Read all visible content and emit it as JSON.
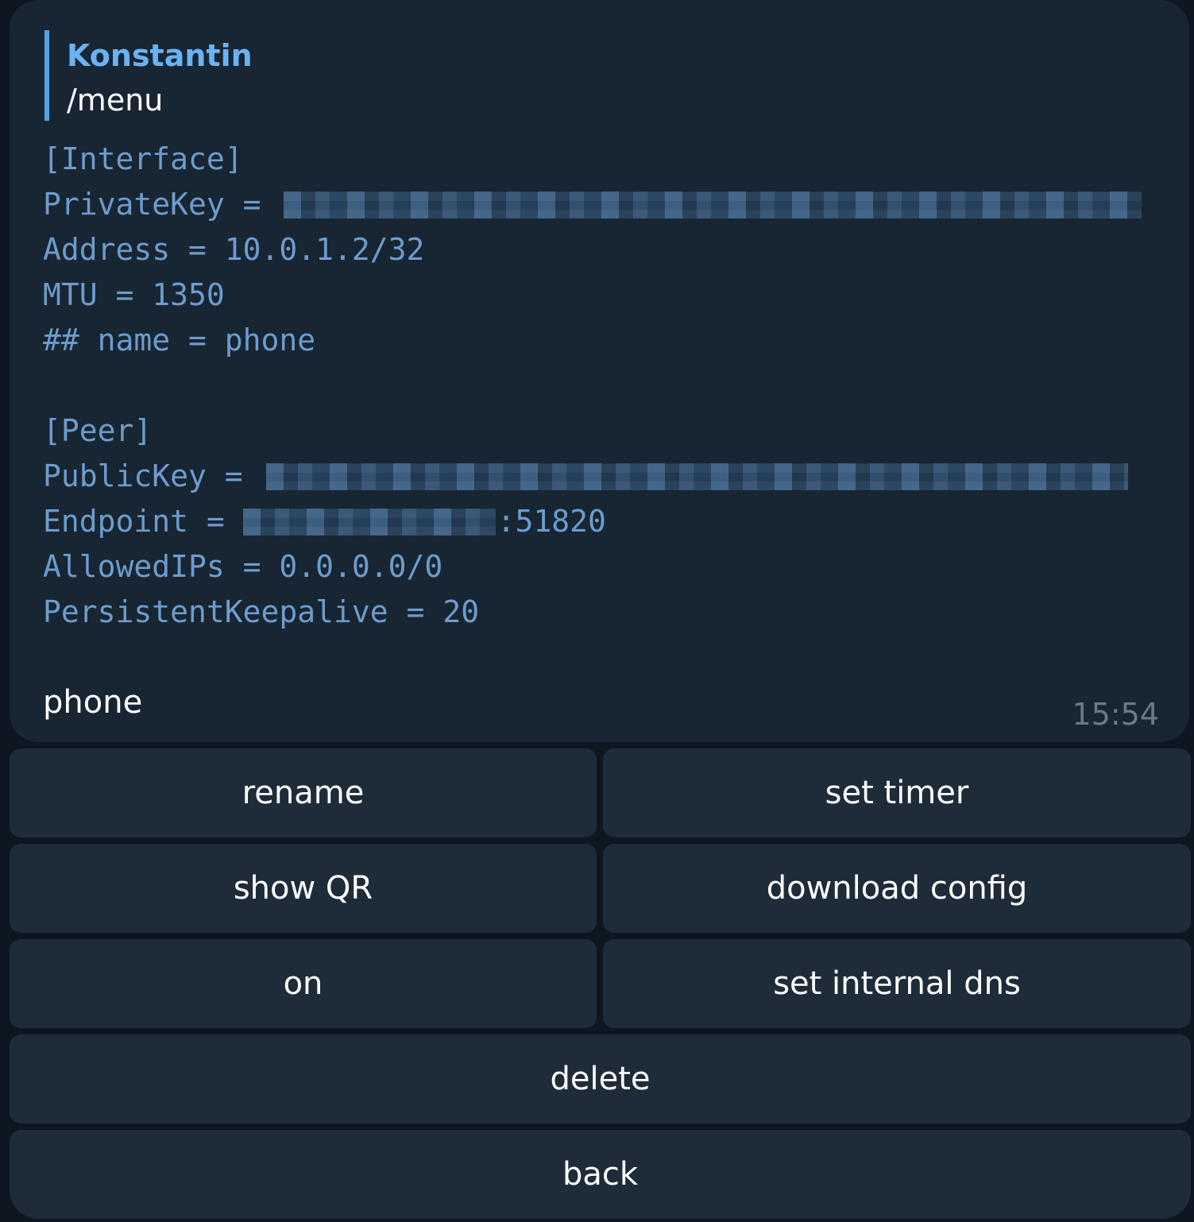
{
  "message": {
    "reply": {
      "author": "Konstantin",
      "text": "/menu"
    },
    "config_lines": [
      {
        "pre": "[Interface]",
        "post": ""
      },
      {
        "pre": "PrivateKey = ",
        "post": "",
        "redacted": true
      },
      {
        "pre": "Address = 10.0.1.2/32",
        "post": ""
      },
      {
        "pre": "MTU = 1350",
        "post": ""
      },
      {
        "pre": "## name = phone",
        "post": ""
      },
      {
        "pre": "",
        "post": ""
      },
      {
        "pre": "[Peer]",
        "post": ""
      },
      {
        "pre": "PublicKey = ",
        "post": "",
        "redacted": true
      },
      {
        "pre": "Endpoint = ",
        "post": ":51820",
        "redacted": true
      },
      {
        "pre": "AllowedIPs = 0.0.0.0/0",
        "post": ""
      },
      {
        "pre": "PersistentKeepalive = 20",
        "post": ""
      }
    ],
    "caption": "phone",
    "time": "15:54"
  },
  "keyboard": {
    "rename": "rename",
    "set_timer": "set timer",
    "show_qr": "show QR",
    "download_config": "download config",
    "on": "on",
    "set_internal_dns": "set internal dns",
    "delete": "delete",
    "back": "back"
  },
  "colors": {
    "background": "#0e1621",
    "bubble": "#182533",
    "button": "#1e2c3a",
    "accent": "#6ab3f3",
    "code": "#6d9ccc"
  }
}
